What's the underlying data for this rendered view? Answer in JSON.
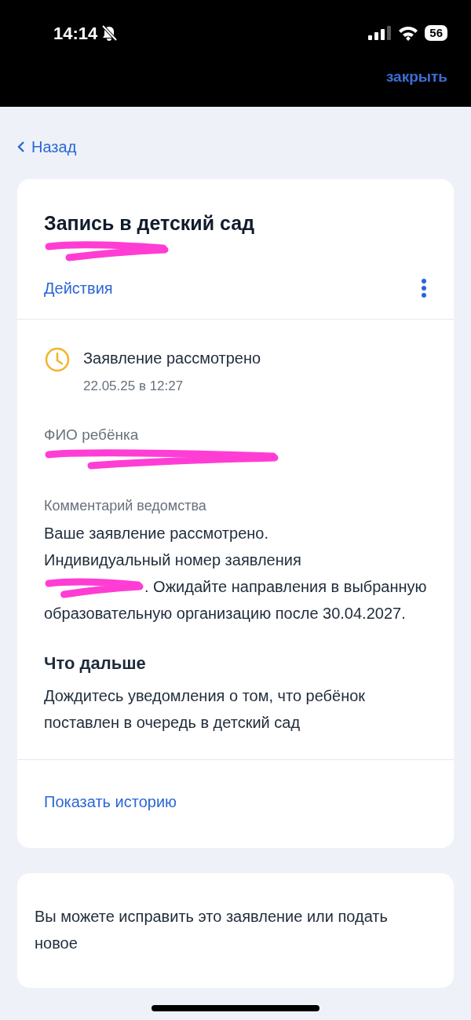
{
  "status_bar": {
    "time": "14:14",
    "silent": true,
    "battery": "56"
  },
  "top_bar": {
    "close": "закрыть"
  },
  "back": {
    "label": "Назад"
  },
  "application": {
    "title": "Запись в детский сад",
    "number": {
      "redacted": true
    },
    "actions": "Действия"
  },
  "status": {
    "text": "Заявление рассмотрено",
    "date": "22.05.25 в 12:27"
  },
  "child": {
    "label": "ФИО ребёнка",
    "value": {
      "redacted": true
    }
  },
  "comment": {
    "label": "Комментарий ведомства",
    "text_before": "Ваше заявление рассмотрено. Индивидуальный номер заявления",
    "number": {
      "redacted": true
    },
    "text_after": ". Ожидайте направления в выбранную образовательную организацию после 30.04.2027."
  },
  "next": {
    "title": "Что дальше",
    "text": "Дождитесь уведомления о том, что ребёнок поставлен в очередь в детский сад"
  },
  "history_link": "Показать историю",
  "notice": {
    "text": "Вы можете исправить это заявление или подать новое"
  }
}
